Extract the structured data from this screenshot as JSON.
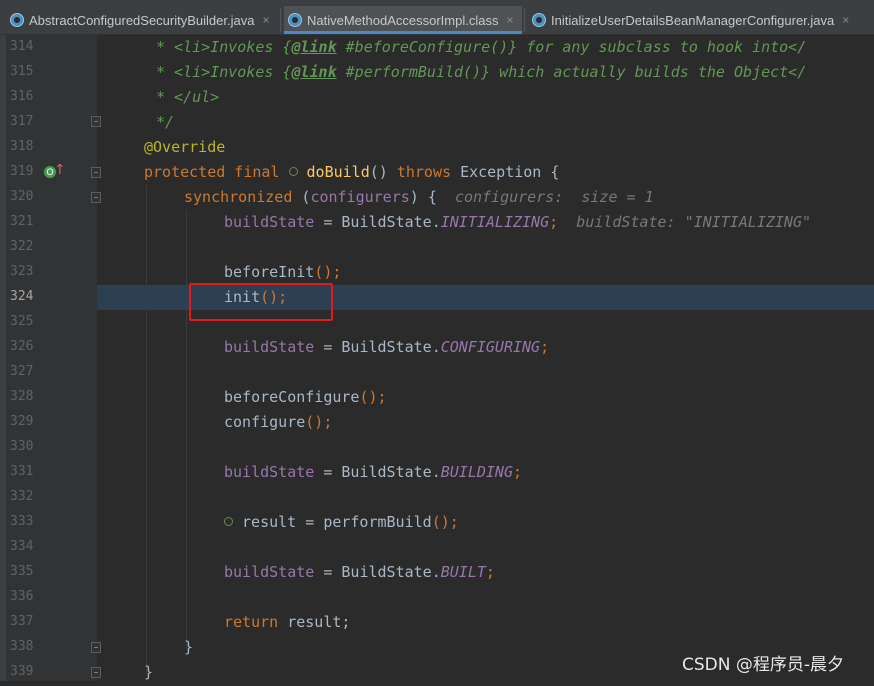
{
  "tabs": [
    {
      "label": "AbstractConfiguredSecurityBuilder.java",
      "close": "×",
      "icon": "java-class-icon"
    },
    {
      "label": "NativeMethodAccessorImpl.class",
      "close": "×",
      "icon": "java-class-icon"
    },
    {
      "label": "InitializeUserDetailsBeanManagerConfigurer.java",
      "close": "×",
      "icon": "java-class-icon"
    }
  ],
  "lines": {
    "l314": {
      "num": "314",
      "a": "* <li>",
      "b": "Invokes {",
      "c": "@link",
      "d": " #beforeConfigure()} for any subclass to hook into</"
    },
    "l315": {
      "num": "315",
      "a": "* <li>",
      "b": "Invokes {",
      "c": "@link",
      "d": " #performBuild()} which actually builds the Object</"
    },
    "l316": {
      "num": "316",
      "a": "* </ul>"
    },
    "l317": {
      "num": "317",
      "a": "*/"
    },
    "l318": {
      "num": "318",
      "a": "@Override"
    },
    "l319": {
      "num": "319",
      "a": "protected final ",
      "b": "doBuild",
      "c": "() ",
      "d": "throws ",
      "e": "Exception {"
    },
    "l320": {
      "num": "320",
      "a": "synchronized ",
      "b": "(",
      "c": "configurers",
      "d": ") {",
      "hint": "configurers:  size = 1"
    },
    "l321": {
      "num": "321",
      "a": "buildState",
      "b": " = BuildState.",
      "c": "INITIALIZING",
      "d": ";",
      "hint": "buildState: \"INITIALIZING\""
    },
    "l322": {
      "num": "322"
    },
    "l323": {
      "num": "323",
      "a": "beforeInit",
      "b": "();"
    },
    "l324": {
      "num": "324",
      "a": "init",
      "b": "();"
    },
    "l325": {
      "num": "325"
    },
    "l326": {
      "num": "326",
      "a": "buildState",
      "b": " = BuildState.",
      "c": "CONFIGURING",
      "d": ";"
    },
    "l327": {
      "num": "327"
    },
    "l328": {
      "num": "328",
      "a": "beforeConfigure",
      "b": "();"
    },
    "l329": {
      "num": "329",
      "a": "configure",
      "b": "();"
    },
    "l330": {
      "num": "330"
    },
    "l331": {
      "num": "331",
      "a": "buildState",
      "b": " = BuildState.",
      "c": "BUILDING",
      "d": ";"
    },
    "l332": {
      "num": "332"
    },
    "l333": {
      "num": "333",
      "a": "result",
      "b": " = ",
      "c": "performBuild",
      "d": "();"
    },
    "l334": {
      "num": "334"
    },
    "l335": {
      "num": "335",
      "a": "buildState",
      "b": " = BuildState.",
      "c": "BUILT",
      "d": ";"
    },
    "l336": {
      "num": "336"
    },
    "l337": {
      "num": "337",
      "a": "return ",
      "b": "result;"
    },
    "l338": {
      "num": "338",
      "a": "}"
    },
    "l339": {
      "num": "339",
      "a": "}"
    }
  },
  "gutter_icons": {
    "override": "override-icon",
    "arrow": "↑",
    "override_glyph": "O"
  },
  "watermark": "CSDN @程序员-晨夕",
  "colors": {
    "keyword": "#cc7832",
    "annotation": "#bbb529",
    "method": "#ffc66d",
    "field": "#9876aa",
    "comment": "#629755",
    "highlight_box": "#e01b1b",
    "execution_line": "#2d4052"
  }
}
